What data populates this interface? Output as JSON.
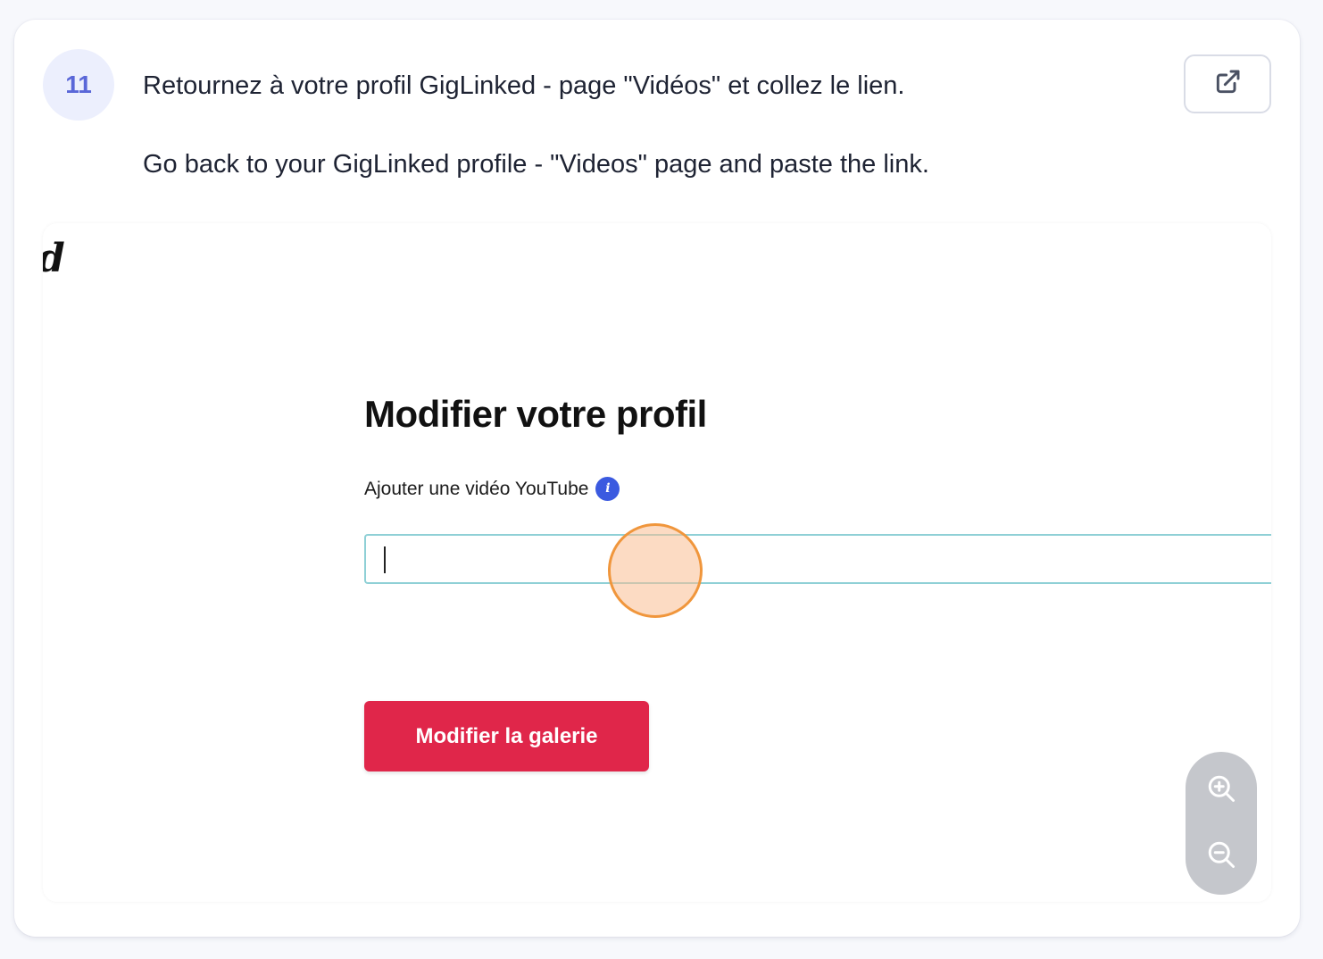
{
  "step": {
    "number": "11",
    "instruction_fr": "Retournez à votre profil GigLinked - page \"Vidéos\" et collez le lien.",
    "instruction_en": "Go back to your GigLinked profile - \"Videos\" page and paste the link."
  },
  "toolbar": {
    "open_icon": "external-link-icon"
  },
  "screenshot": {
    "logo_fragment": "d",
    "heading": "Modifier votre profil",
    "field_label": "Ajouter une vidéo YouTube",
    "info_icon": "info-icon",
    "input_value": "",
    "button_label": "Modifier la galerie"
  },
  "zoom": {
    "zoom_in_icon": "zoom-in-icon",
    "zoom_out_icon": "zoom-out-icon"
  },
  "colors": {
    "badge_bg": "#eceffd",
    "badge_text": "#5a67d8",
    "primary_button": "#e0264a",
    "click_highlight": "#f0963c",
    "input_border": "#8fd0d6"
  }
}
